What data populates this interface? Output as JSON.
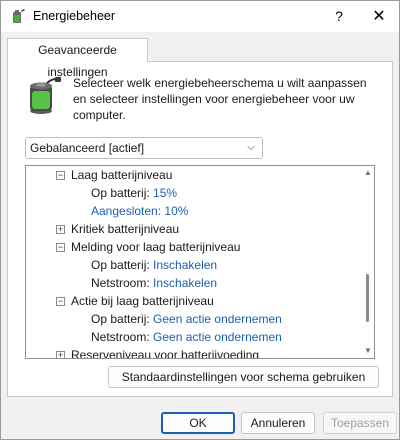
{
  "window": {
    "title": "Energiebeheer",
    "help_label": "?",
    "close_label": "✕"
  },
  "tab": {
    "label": "Geavanceerde instellingen"
  },
  "intro_text": "Selecteer welk energiebeheerschema u wilt aanpassen en selecteer instellingen voor energiebeheer voor uw computer.",
  "plan_select": {
    "value": "Gebalanceerd [actief]"
  },
  "tree": {
    "items": [
      {
        "toggle": "−",
        "label": "Laag batterijniveau"
      },
      {
        "label": "Op batterij:",
        "value": "15%"
      },
      {
        "label": "",
        "value": "Aangesloten: 10%"
      },
      {
        "toggle": "+",
        "label": "Kritiek batterijniveau"
      },
      {
        "toggle": "−",
        "label": "Melding voor laag batterijniveau"
      },
      {
        "label": "Op batterij:",
        "value": "Inschakelen"
      },
      {
        "label": "Netstroom:",
        "value": "Inschakelen"
      },
      {
        "toggle": "−",
        "label": "Actie bij laag batterijniveau"
      },
      {
        "label": "Op batterij:",
        "value": "Geen actie ondernemen"
      },
      {
        "label": "Netstroom:",
        "value": "Geen actie ondernemen"
      },
      {
        "toggle": "+",
        "label": "Reserveniveau voor batterijvoeding"
      }
    ]
  },
  "buttons": {
    "restore_defaults": "Standaardinstellingen voor schema gebruiken",
    "ok": "OK",
    "cancel": "Annuleren",
    "apply": "Toepassen"
  },
  "icons": {
    "title": "battery-plug-icon",
    "main": "battery-power-icon"
  }
}
